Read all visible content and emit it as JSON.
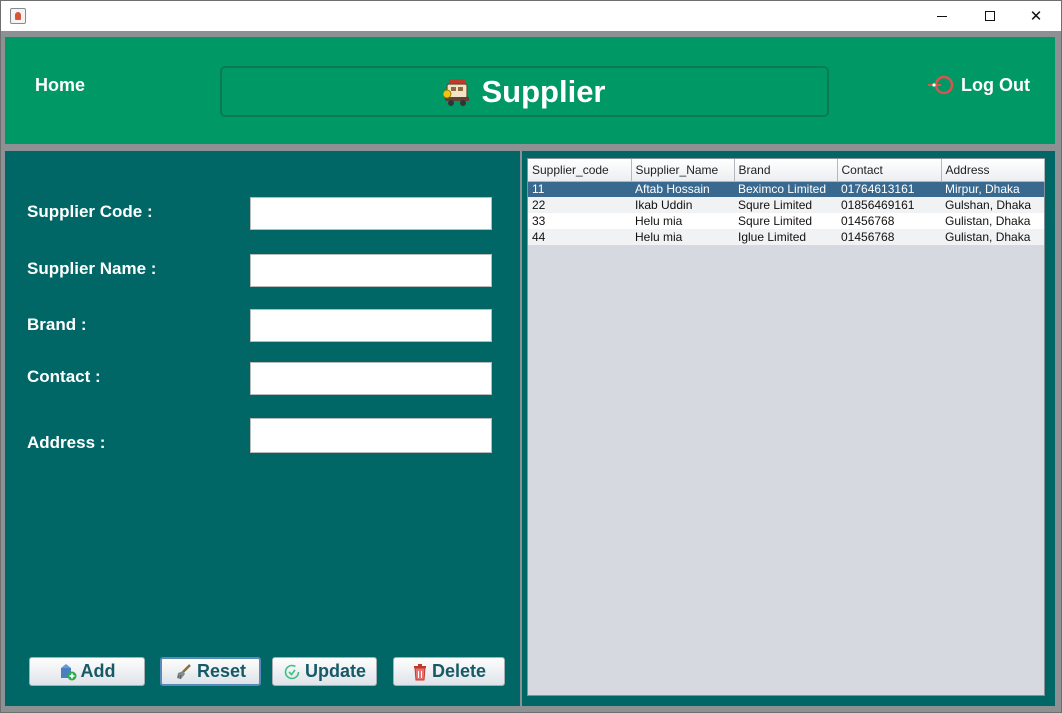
{
  "window": {
    "controls": {
      "minimize": "—",
      "maximize": "☐",
      "close": "✕"
    }
  },
  "header": {
    "home_label": "Home",
    "title": "Supplier",
    "logout_label": "Log Out"
  },
  "form": {
    "supplier_code_label": "Supplier Code :",
    "supplier_name_label": "Supplier Name :",
    "brand_label": "Brand :",
    "contact_label": "Contact :",
    "address_label": "Address :",
    "supplier_code_value": "",
    "supplier_name_value": "",
    "brand_value": "",
    "contact_value": "",
    "address_value": ""
  },
  "buttons": {
    "add": "Add",
    "reset": "Reset",
    "update": "Update",
    "delete": "Delete"
  },
  "table": {
    "columns": [
      "Supplier_code",
      "Supplier_Name",
      "Brand",
      "Contact",
      "Address"
    ],
    "rows": [
      [
        "11",
        "Aftab Hossain",
        "Beximco Limited",
        "01764613161",
        "Mirpur, Dhaka"
      ],
      [
        "22",
        "Ikab Uddin",
        "Squre Limited",
        "01856469161",
        "Gulshan, Dhaka"
      ],
      [
        "33",
        "Helu mia",
        "Squre Limited",
        "01456768",
        "Gulistan, Dhaka"
      ],
      [
        "44",
        "Helu mia",
        "Iglue Limited",
        "01456768",
        "Gulistan, Dhaka"
      ]
    ],
    "selected_row": 0
  },
  "colors": {
    "header_green": "#009966",
    "panel_teal": "#006666",
    "selection_blue": "#39698f",
    "button_text": "#155a66"
  },
  "icons": {
    "supplier": "supplier-icon",
    "logout": "logout-icon",
    "add": "add-icon",
    "reset": "brush-icon",
    "update": "refresh-check-icon",
    "delete": "trash-icon"
  }
}
